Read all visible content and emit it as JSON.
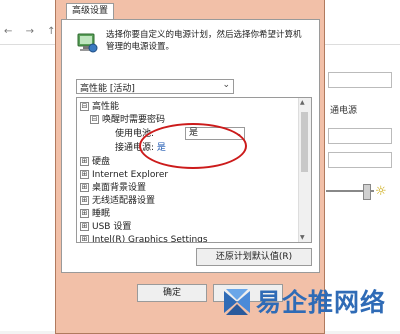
{
  "background": {
    "nav_icons": [
      "back-icon",
      "forward-icon",
      "up-icon"
    ],
    "partial_text": "通电源"
  },
  "dialog": {
    "tab_label": "高级设置",
    "description": "选择你要自定义的电源计划，然后选择你希望计算机管理的电源设置。",
    "plan_select_value": "高性能 [活动]",
    "tree": {
      "items": [
        {
          "label": "高性能",
          "expander": "⊟"
        },
        {
          "label": "唤醒时需要密码",
          "expander": "⊟"
        },
        {
          "label": "使用电池:",
          "value": "是"
        },
        {
          "label": "接通电源:",
          "value": "是"
        },
        {
          "label": "硬盘",
          "expander": "⊞"
        },
        {
          "label": "Internet Explorer",
          "expander": "⊞"
        },
        {
          "label": "桌面背景设置",
          "expander": "⊞"
        },
        {
          "label": "无线适配器设置",
          "expander": "⊞"
        },
        {
          "label": "睡眠",
          "expander": "⊞"
        },
        {
          "label": "USB 设置",
          "expander": "⊞"
        },
        {
          "label": "Intel(R) Graphics Settings",
          "expander": "⊞"
        }
      ]
    },
    "restore_button": "还原计划默认值(R)",
    "ok_button": "确定"
  },
  "watermark": {
    "text": "易企推网络"
  },
  "colors": {
    "dialog_frame": "#f2c0a8",
    "highlight": "#cc1b1b",
    "link": "#1a55b0",
    "watermark": "#2f6bb6"
  }
}
